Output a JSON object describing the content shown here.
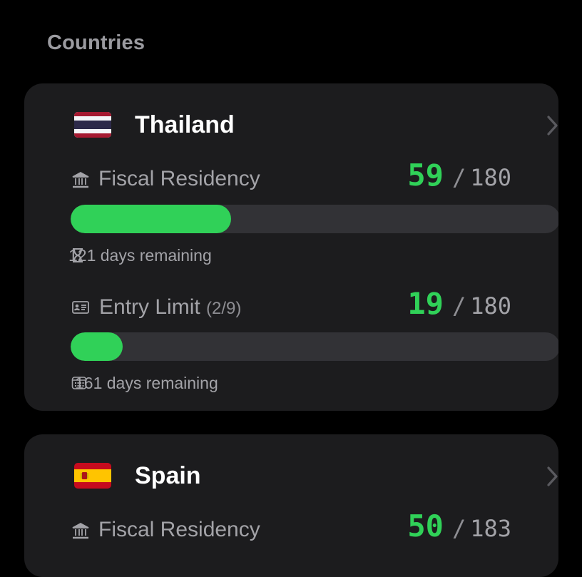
{
  "section": {
    "title": "Countries"
  },
  "countries": [
    {
      "name": "Thailand",
      "flag": "thailand-flag-icon",
      "fiscal": {
        "label": "Fiscal Residency",
        "current": "59",
        "limit": "180",
        "progress": 0.328,
        "remaining": "121 days remaining"
      },
      "entry": {
        "label": "Entry Limit",
        "entries": "(2/9)",
        "current": "19",
        "limit": "180",
        "progress": 0.106,
        "remaining": "161 days remaining"
      }
    },
    {
      "name": "Spain",
      "flag": "spain-flag-icon",
      "fiscal": {
        "label": "Fiscal Residency",
        "current": "50",
        "limit": "183"
      }
    }
  ],
  "separator": "/",
  "colors": {
    "accent": "#30d158",
    "card": "#1c1c1e",
    "track": "#323236",
    "background": "#000000"
  }
}
